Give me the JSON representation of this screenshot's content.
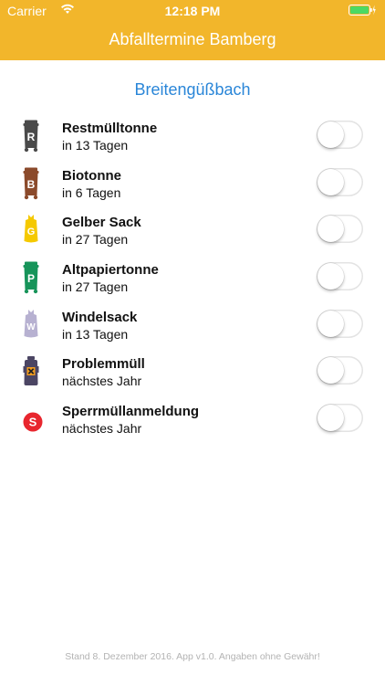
{
  "status_bar": {
    "carrier": "Carrier",
    "time": "12:18 PM",
    "wifi_icon": "wifi-icon",
    "battery_icon": "battery-charging-icon"
  },
  "header": {
    "title": "Abfalltermine Bamberg",
    "background": "#f2b62b"
  },
  "location": "Breitengüßbach",
  "items": [
    {
      "name": "Restmülltonne",
      "due": "in 13 Tagen",
      "icon": "residual-waste-bin-icon",
      "letter": "R",
      "color": "#4a4a4a",
      "enabled": false
    },
    {
      "name": "Biotonne",
      "due": "in 6 Tagen",
      "icon": "organic-bin-icon",
      "letter": "B",
      "color": "#8b4a2b",
      "enabled": false
    },
    {
      "name": "Gelber Sack",
      "due": "in 27 Tagen",
      "icon": "yellow-bag-icon",
      "letter": "G",
      "color": "#f5c900",
      "enabled": false
    },
    {
      "name": "Altpapiertonne",
      "due": "in 27 Tagen",
      "icon": "paper-bin-icon",
      "letter": "P",
      "color": "#17945a",
      "enabled": false
    },
    {
      "name": "Windelsack",
      "due": "in 13 Tagen",
      "icon": "diaper-bag-icon",
      "letter": "W",
      "color": "#b7b1d1",
      "enabled": false
    },
    {
      "name": "Problemmüll",
      "due": "nächstes Jahr",
      "icon": "hazardous-waste-icon",
      "letter": "",
      "color": "#4b4563",
      "enabled": false
    },
    {
      "name": "Sperrmüllanmeldung",
      "due": "nächstes Jahr",
      "icon": "bulky-waste-icon",
      "letter": "S",
      "color": "#e8262e",
      "enabled": false
    }
  ],
  "footer": "Stand 8. Dezember 2016. App v1.0. Angaben ohne Gewähr!"
}
